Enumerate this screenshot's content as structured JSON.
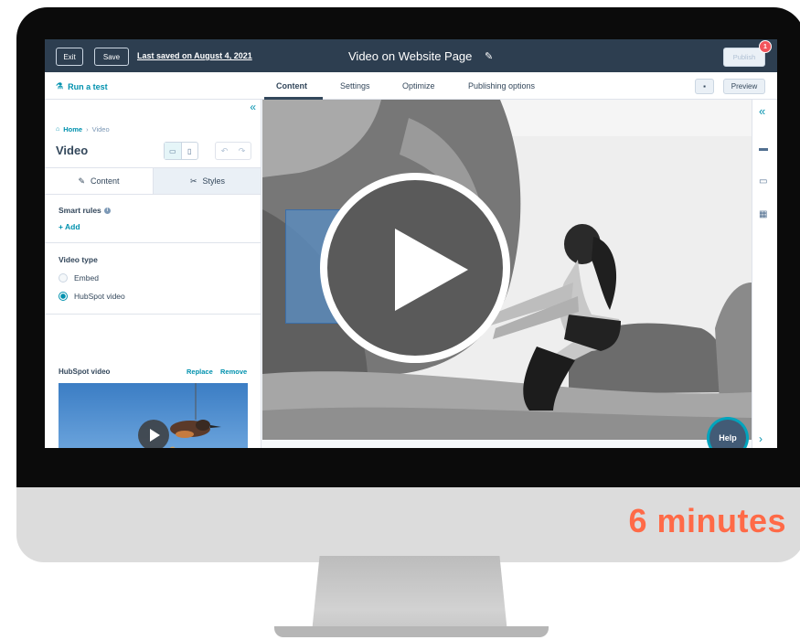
{
  "topbar": {
    "exit_label": "Exit",
    "save_label": "Save",
    "last_saved": "Last saved on August 4, 2021",
    "page_title": "Video on Website Page",
    "publish_label": "Publish",
    "notification_count": "1"
  },
  "tabbar": {
    "run_test": "Run a test",
    "tabs": [
      "Content",
      "Settings",
      "Optimize",
      "Publishing options"
    ],
    "active_tab": "Content",
    "preview_label": "Preview"
  },
  "sidebar": {
    "breadcrumb": {
      "home": "Home",
      "separator": "›",
      "current": "Video"
    },
    "title": "Video",
    "tabs": {
      "content": "Content",
      "styles": "Styles"
    },
    "smart_rules_label": "Smart rules",
    "add_label": "+ Add",
    "video_type_label": "Video type",
    "video_type_options": [
      "Embed",
      "HubSpot video"
    ],
    "video_type_selected": "HubSpot video",
    "hubspot_video_label": "HubSpot video",
    "replace_label": "Replace",
    "remove_label": "Remove"
  },
  "help_label": "Help",
  "duration_text": "6 minutes",
  "colors": {
    "header_bg": "#2d3e50",
    "accent": "#0091ae",
    "duration": "#ff6a47",
    "notification": "#f2545b"
  },
  "icons": [
    "pencil-icon",
    "flask-icon",
    "home-icon",
    "desktop-icon",
    "mobile-icon",
    "undo-icon",
    "redo-icon",
    "pencil-icon",
    "styles-icon",
    "info-icon",
    "play-icon",
    "collapse-icon",
    "comment-icon",
    "layout-icon",
    "calendar-icon",
    "chevron-right-icon"
  ]
}
